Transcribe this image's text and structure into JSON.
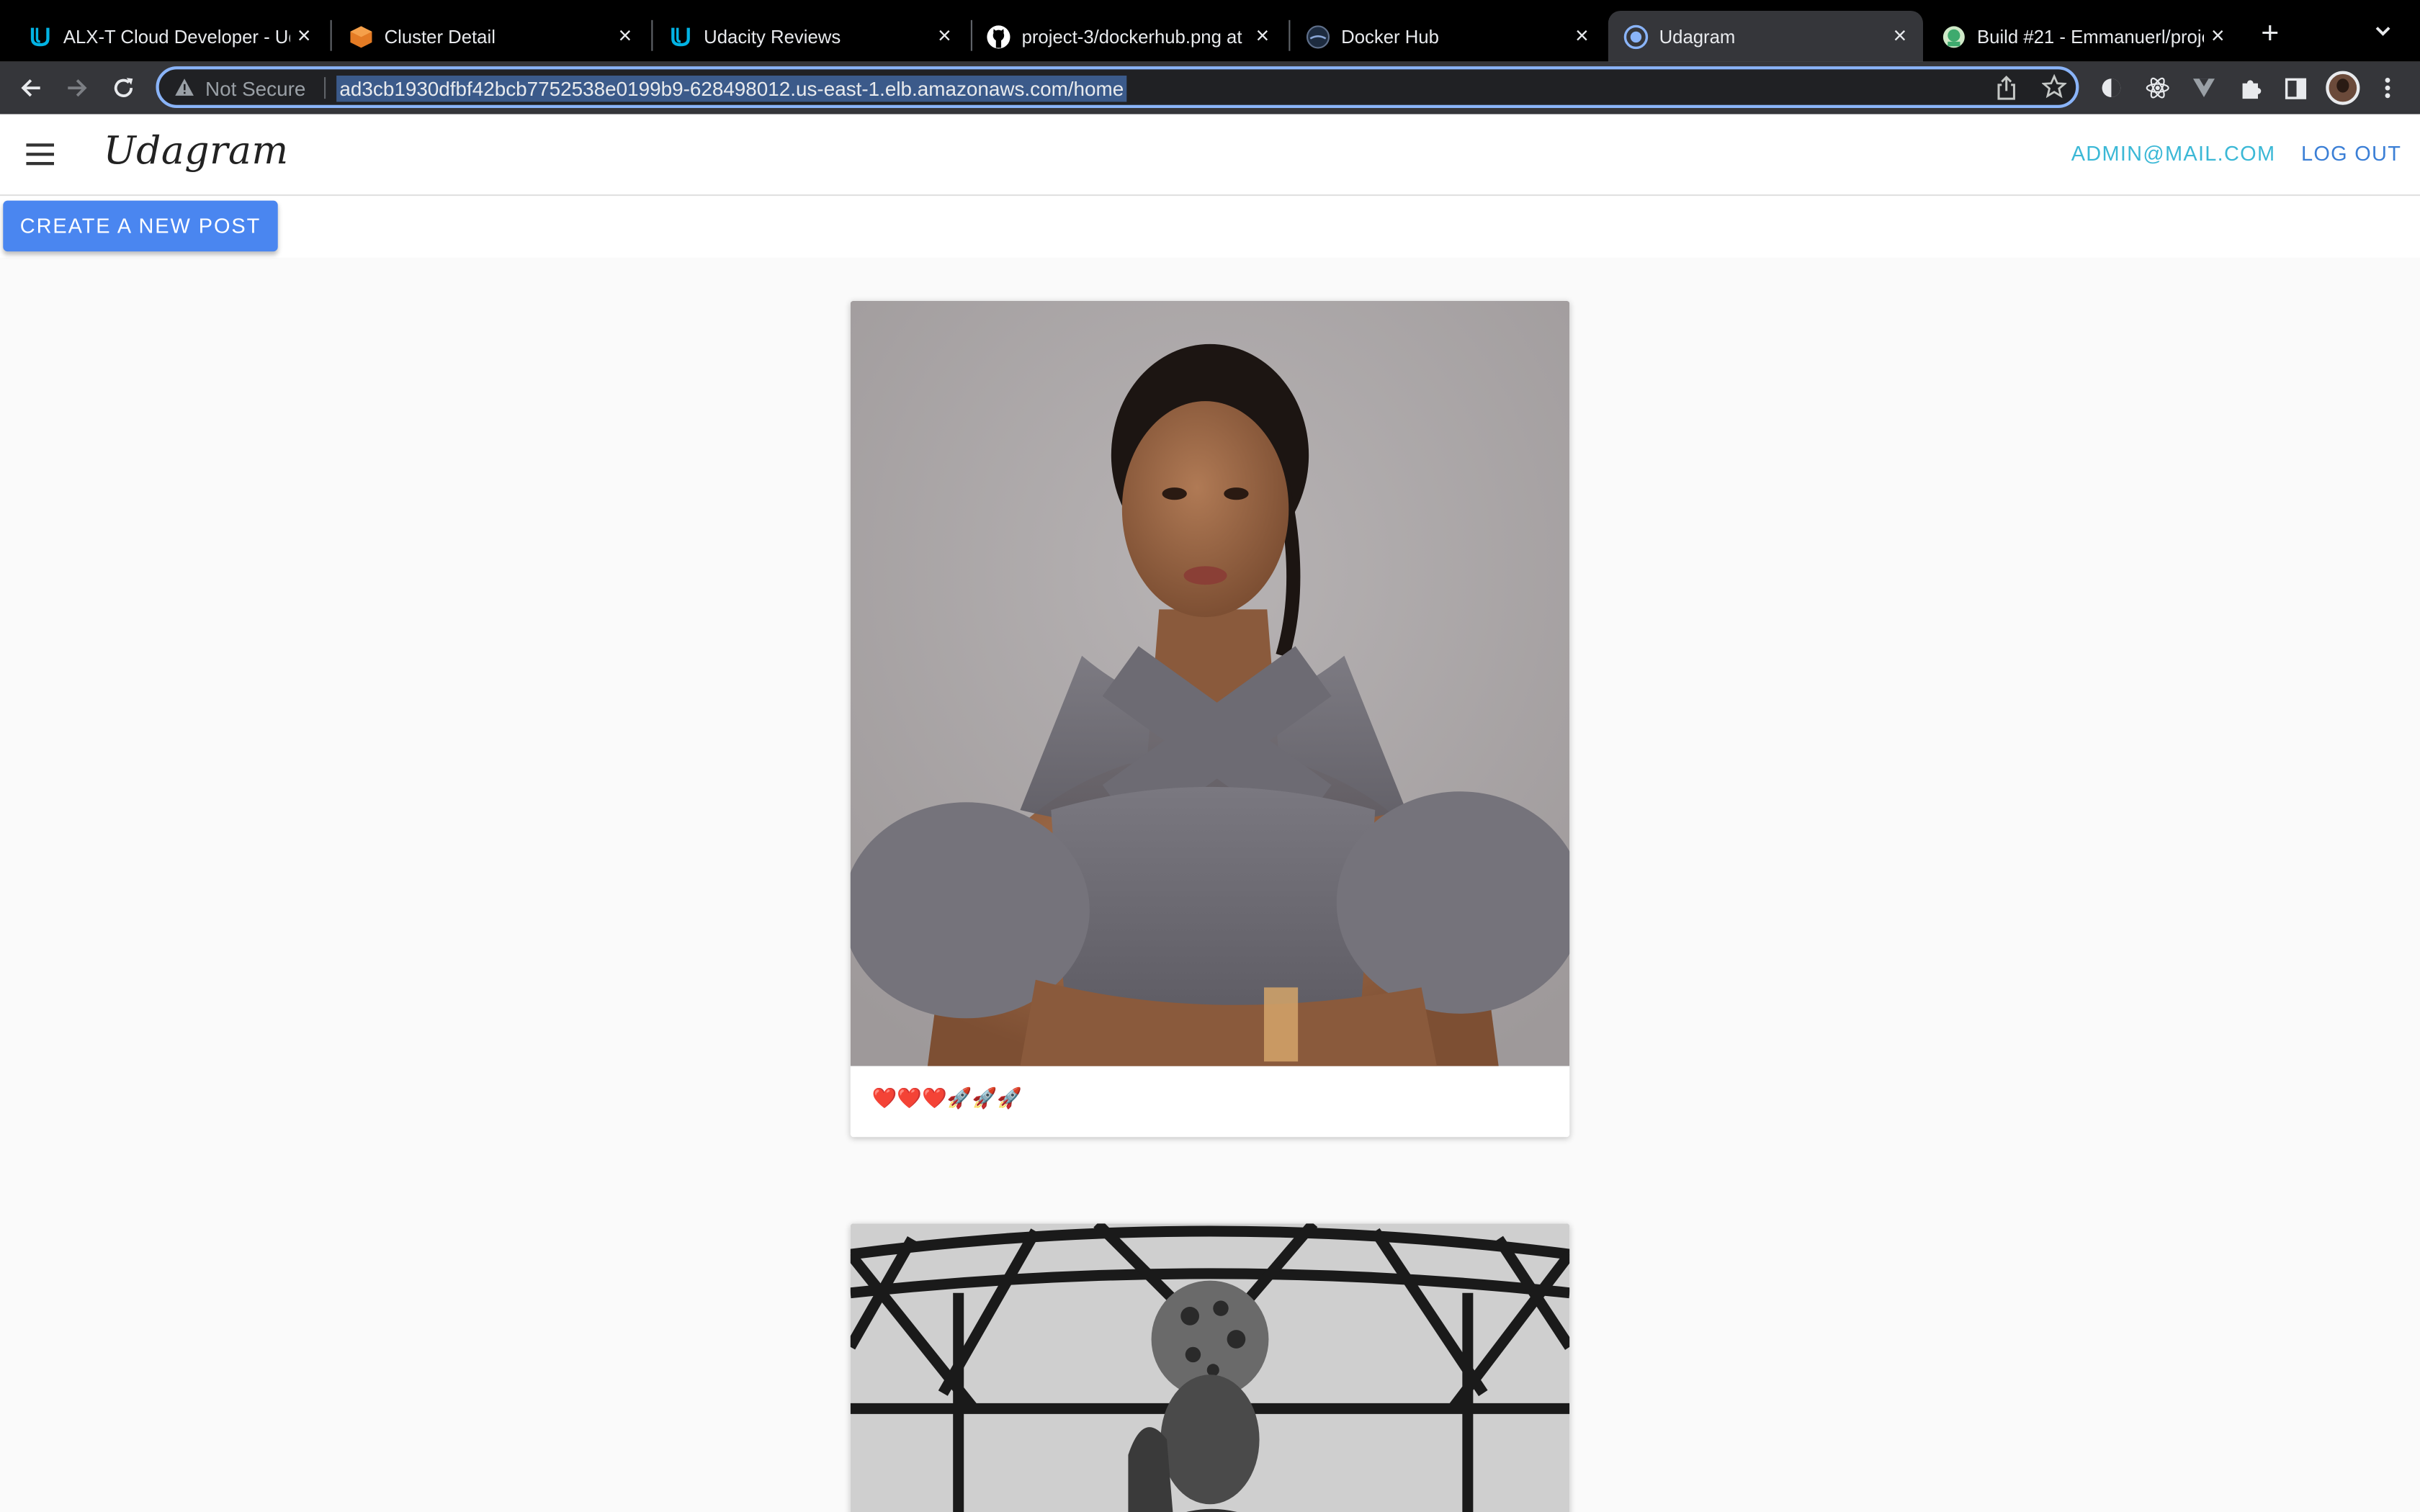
{
  "browser": {
    "tabs": [
      {
        "title": "ALX-T Cloud Developer - Uda",
        "icon": "udacity-icon",
        "active": false
      },
      {
        "title": "Cluster Detail",
        "icon": "aws-cube-icon",
        "active": false
      },
      {
        "title": "Udacity Reviews",
        "icon": "udacity-icon",
        "active": false
      },
      {
        "title": "project-3/dockerhub.png at",
        "icon": "github-icon",
        "active": false
      },
      {
        "title": "Docker Hub",
        "icon": "docker-icon",
        "active": false
      },
      {
        "title": "Udagram",
        "icon": "globe-icon",
        "active": true
      },
      {
        "title": "Build #21 - Emmanuerl/proje",
        "icon": "travis-icon",
        "active": false
      }
    ],
    "security_label": "Not Secure",
    "url": "ad3cb1930dfbf42bcb7752538e0199b9-628498012.us-east-1.elb.amazonaws.com/home"
  },
  "app": {
    "brand": "Udagram",
    "user_email": "ADMIN@MAIL.COM",
    "logout_label": "LOG OUT",
    "create_post_label": "CREATE A NEW POST"
  },
  "feed": {
    "posts": [
      {
        "caption": "❤️❤️❤️🚀🚀🚀",
        "image": "portrait of woman in grey feathered dress"
      },
      {
        "caption": "",
        "image": "black and white portrait of woman in headwrap under metal roof"
      }
    ]
  },
  "colors": {
    "accent": "#4a86f0",
    "email_link": "#3bb8d6",
    "logout_link": "#3b7fd6",
    "omnibox_focus": "#8ab4f8"
  }
}
